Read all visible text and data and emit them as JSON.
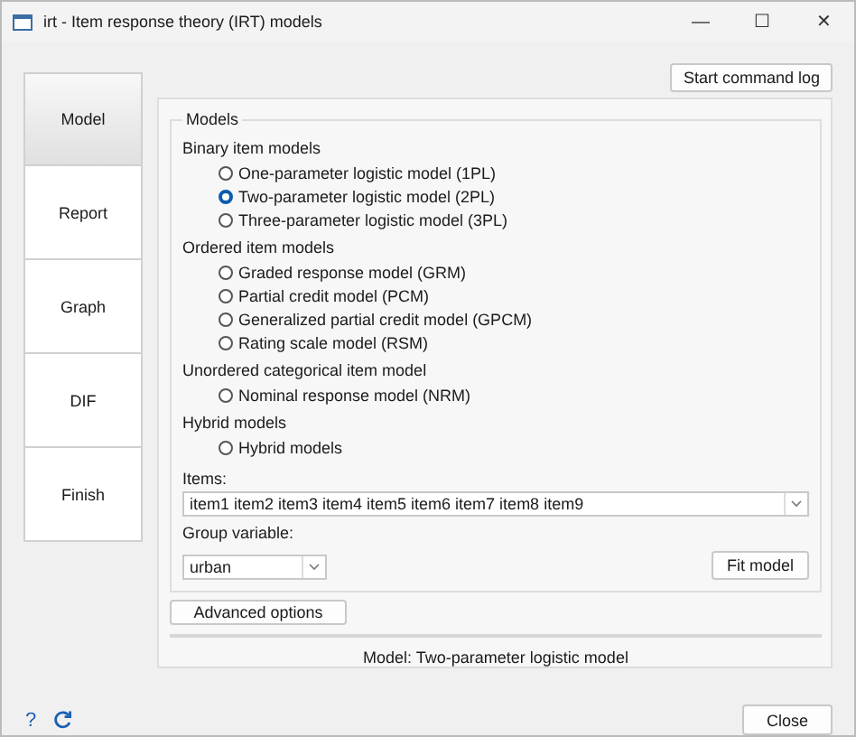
{
  "window": {
    "title": "irt - Item response theory (IRT) models",
    "controls": [
      "—",
      "☐",
      "✕"
    ]
  },
  "command_log_button": "Start command log",
  "tabs": [
    {
      "label": "Model",
      "selected": true
    },
    {
      "label": "Report",
      "selected": false
    },
    {
      "label": "Graph",
      "selected": false
    },
    {
      "label": "DIF",
      "selected": false
    },
    {
      "label": "Finish",
      "selected": false
    }
  ],
  "models": {
    "title": "Models",
    "groups": [
      {
        "label": "Binary item models",
        "options": [
          {
            "label": "One-parameter logistic model (1PL)",
            "selected": false
          },
          {
            "label": "Two-parameter logistic model (2PL)",
            "selected": true
          },
          {
            "label": "Three-parameter logistic model (3PL)",
            "selected": false
          }
        ]
      },
      {
        "label": "Ordered item models",
        "options": [
          {
            "label": "Graded response model (GRM)",
            "selected": false
          },
          {
            "label": "Partial credit model (PCM)",
            "selected": false
          },
          {
            "label": "Generalized partial credit model (GPCM)",
            "selected": false
          },
          {
            "label": "Rating scale model (RSM)",
            "selected": false
          }
        ]
      },
      {
        "label": "Unordered categorical item model",
        "options": [
          {
            "label": "Nominal response model (NRM)",
            "selected": false
          }
        ]
      },
      {
        "label": "Hybrid models",
        "options": [
          {
            "label": "Hybrid models",
            "selected": false
          }
        ]
      }
    ],
    "items_label": "Items:",
    "items_value": "item1 item2 item3 item4 item5 item6 item7 item8 item9",
    "group_label": "Group variable:",
    "group_value": "urban",
    "fit_button": "Fit model"
  },
  "advanced_button": "Advanced options",
  "status": "Model: Two-parameter logistic model",
  "footer": {
    "help": "?",
    "close_button": "Close"
  }
}
